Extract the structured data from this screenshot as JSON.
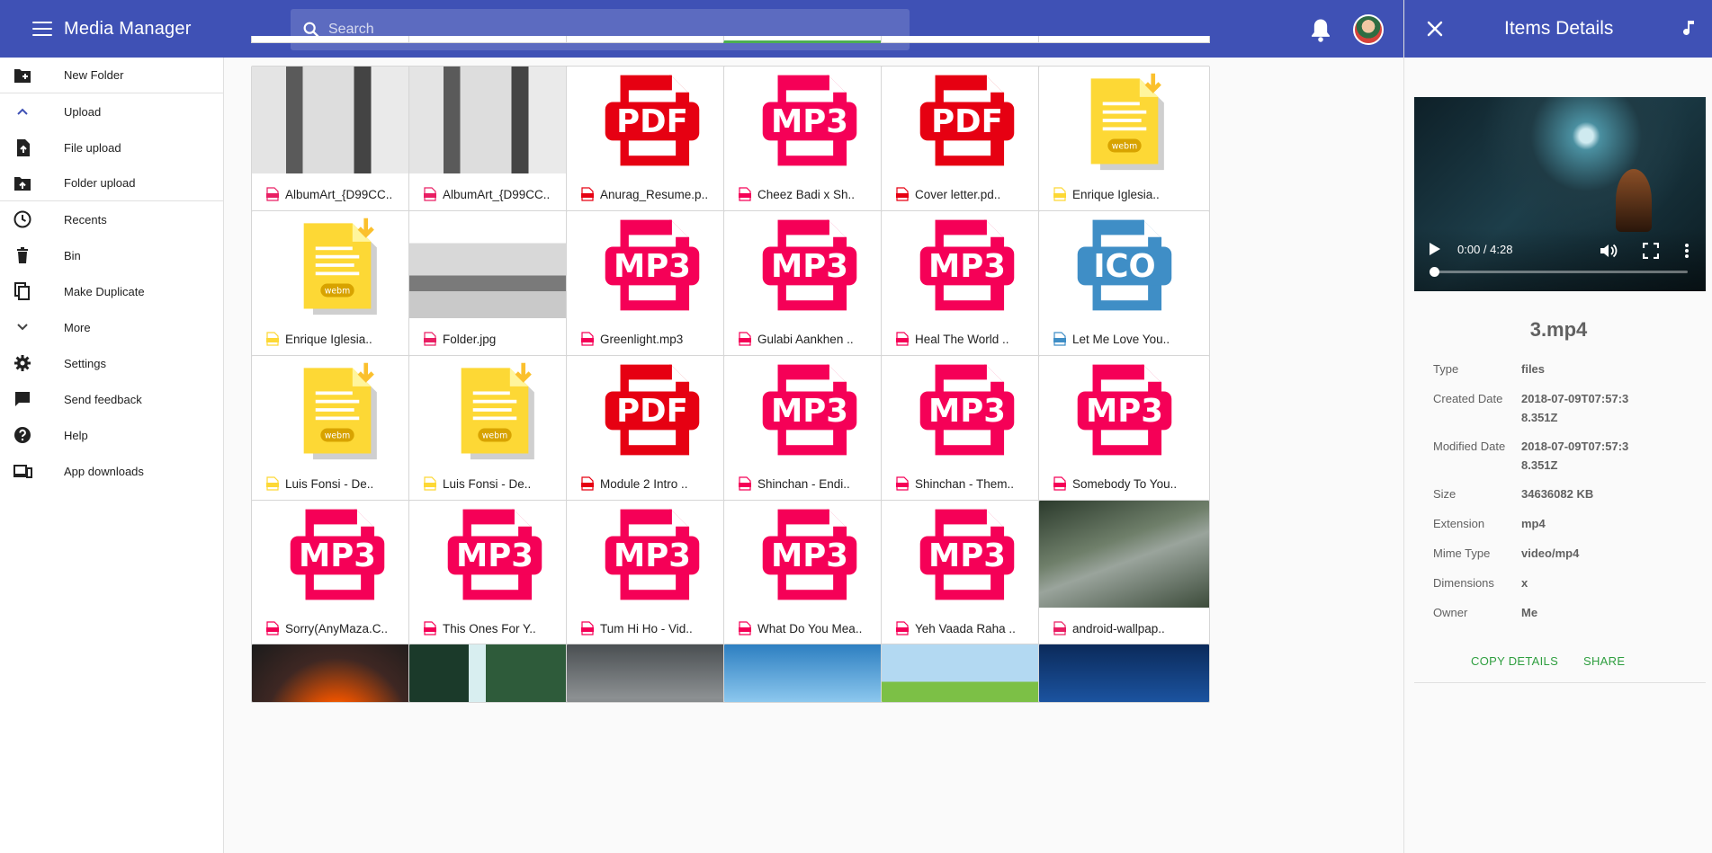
{
  "app": {
    "title": "Media Manager",
    "search_placeholder": "Search",
    "colors": {
      "primary": "#3f51b5",
      "search_bg": "#5c6bc0",
      "accent_green": "#2e9e3f",
      "mp3": "#f50057",
      "pdf": "#e60012",
      "ico": "#3f8ec6",
      "webm": "#fdd835"
    }
  },
  "sidebar": {
    "items": [
      {
        "label": "New Folder",
        "icon": "create-new-folder-icon"
      },
      {
        "label": "Upload",
        "icon": "chevron-up-icon"
      },
      {
        "label": "File upload",
        "icon": "file-upload-icon"
      },
      {
        "label": "Folder upload",
        "icon": "folder-upload-icon"
      },
      {
        "label": "Recents",
        "icon": "clock-icon"
      },
      {
        "label": "Bin",
        "icon": "trash-icon"
      },
      {
        "label": "Make Duplicate",
        "icon": "duplicate-icon"
      },
      {
        "label": "More",
        "icon": "chevron-down-icon"
      },
      {
        "label": "Settings",
        "icon": "gear-icon"
      },
      {
        "label": "Send feedback",
        "icon": "feedback-icon"
      },
      {
        "label": "Help",
        "icon": "help-icon"
      },
      {
        "label": "App downloads",
        "icon": "devices-icon"
      }
    ]
  },
  "files": [
    {
      "name": "AlbumArt_{D99CC..",
      "type": "jpg",
      "thumb": "photo-album-art"
    },
    {
      "name": "AlbumArt_{D99CC..",
      "type": "jpg",
      "thumb": "photo-album-art"
    },
    {
      "name": "Anurag_Resume.p..",
      "type": "pdf",
      "thumb": "PDF"
    },
    {
      "name": "Cheez Badi x Sh..",
      "type": "mp3",
      "thumb": "MP3"
    },
    {
      "name": "Cover letter.pd..",
      "type": "pdf",
      "thumb": "PDF"
    },
    {
      "name": "Enrique Iglesia..",
      "type": "webm",
      "thumb": "webm"
    },
    {
      "name": "Enrique Iglesia..",
      "type": "webm",
      "thumb": "webm"
    },
    {
      "name": "Folder.jpg",
      "type": "jpg",
      "thumb": "photo-band"
    },
    {
      "name": "Greenlight.mp3",
      "type": "mp3",
      "thumb": "MP3"
    },
    {
      "name": "Gulabi Aankhen ..",
      "type": "mp3",
      "thumb": "MP3"
    },
    {
      "name": "Heal The World ..",
      "type": "mp3",
      "thumb": "MP3"
    },
    {
      "name": "Let Me Love You..",
      "type": "ico",
      "thumb": "ICO"
    },
    {
      "name": "Luis Fonsi - De..",
      "type": "webm",
      "thumb": "webm"
    },
    {
      "name": "Luis Fonsi - De..",
      "type": "webm",
      "thumb": "webm"
    },
    {
      "name": "Module 2 Intro ..",
      "type": "pdf",
      "thumb": "PDF"
    },
    {
      "name": "Shinchan - Endi..",
      "type": "mp3",
      "thumb": "MP3"
    },
    {
      "name": "Shinchan - Them..",
      "type": "mp3",
      "thumb": "MP3"
    },
    {
      "name": "Somebody To You..",
      "type": "mp3",
      "thumb": "MP3"
    },
    {
      "name": "Sorry(AnyMaza.C..",
      "type": "mp3",
      "thumb": "MP3"
    },
    {
      "name": "This Ones For Y..",
      "type": "mp3",
      "thumb": "MP3"
    },
    {
      "name": "Tum Hi Ho - Vid..",
      "type": "mp3",
      "thumb": "MP3"
    },
    {
      "name": "What Do You Mea..",
      "type": "mp3",
      "thumb": "MP3"
    },
    {
      "name": "Yeh Vaada Raha ..",
      "type": "mp3",
      "thumb": "MP3"
    },
    {
      "name": "android-wallpap..",
      "type": "jpg",
      "thumb": "photo-road"
    },
    {
      "name": "",
      "type": "jpg",
      "thumb": "photo-sunset"
    },
    {
      "name": "",
      "type": "jpg",
      "thumb": "photo-waterfall"
    },
    {
      "name": "",
      "type": "jpg",
      "thumb": "photo-storm"
    },
    {
      "name": "",
      "type": "jpg",
      "thumb": "photo-tree"
    },
    {
      "name": "",
      "type": "jpg",
      "thumb": "photo-hills"
    },
    {
      "name": "",
      "type": "jpg",
      "thumb": "photo-underwater"
    }
  ],
  "details": {
    "panel_title": "Items Details",
    "file_name": "3.mp4",
    "video_time": "0:00 / 4:28",
    "progress": 0,
    "rows": [
      {
        "k": "Type",
        "v": "files"
      },
      {
        "k": "Created Date",
        "v": "2018-07-09T07:57:38.351Z"
      },
      {
        "k": "Modified Date",
        "v": "2018-07-09T07:57:38.351Z"
      },
      {
        "k": "Size",
        "v": "34636082 KB"
      },
      {
        "k": "Extension",
        "v": "mp4"
      },
      {
        "k": "Mime Type",
        "v": "video/mp4"
      },
      {
        "k": "Dimensions",
        "v": "x"
      },
      {
        "k": "Owner",
        "v": "Me"
      }
    ],
    "copy_label": "COPY DETAILS",
    "share_label": "SHARE"
  }
}
